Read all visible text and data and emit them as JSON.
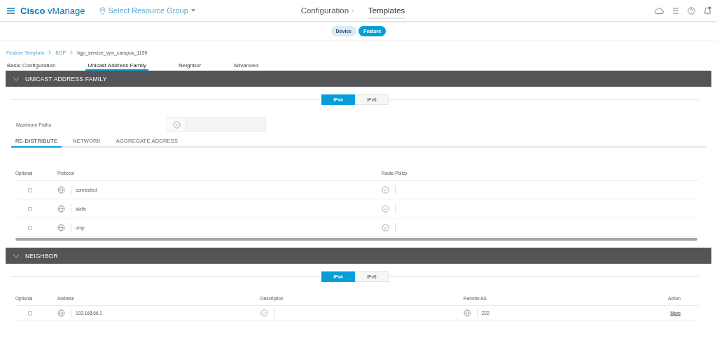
{
  "header": {
    "brand_bold": "Cisco",
    "brand_rest": "vManage",
    "resource_group": "Select Resource Group",
    "title": "Configuration",
    "separator": "·",
    "subtitle": "Templates"
  },
  "template_toggle": [
    {
      "label": "Device",
      "selected": false
    },
    {
      "label": "Feature",
      "selected": true
    }
  ],
  "breadcrumb": [
    "Feature Template",
    "BGP",
    "bgp_service_vpn_campus_1159"
  ],
  "tabs": [
    {
      "label": "Basic Configuration",
      "selected": false
    },
    {
      "label": "Unicast Address Family",
      "selected": true
    },
    {
      "label": "Neighbor",
      "selected": false
    },
    {
      "label": "Advanced",
      "selected": false
    }
  ],
  "unicast": {
    "title": "UNICAST ADDRESS FAMILY",
    "ip_toggle": [
      {
        "label": "IPv4",
        "selected": true
      },
      {
        "label": "IPv6",
        "selected": false
      }
    ],
    "maximum_paths": {
      "label": "Maximum Paths"
    },
    "subtabs": [
      {
        "label": "RE-DISTRIBUTE",
        "selected": true
      },
      {
        "label": "NETWORK",
        "selected": false
      },
      {
        "label": "AGGREGATE ADDRESS",
        "selected": false
      }
    ],
    "table": {
      "columns": [
        "Optional",
        "Protocol",
        "Route Policy"
      ],
      "rows": [
        {
          "checked": false,
          "protocol": "connected"
        },
        {
          "checked": false,
          "protocol": "static"
        },
        {
          "checked": false,
          "protocol": "omp"
        }
      ]
    }
  },
  "neighbor": {
    "title": "NEIGHBOR",
    "ip_toggle": [
      {
        "label": "IPv4",
        "selected": true
      },
      {
        "label": "IPv6",
        "selected": false
      }
    ],
    "table": {
      "columns": [
        "Optional",
        "Address",
        "Description",
        "Remote AS",
        "Action"
      ],
      "rows": [
        {
          "checked": false,
          "address": "192.168.66.1",
          "remote_as": "222",
          "action": "More"
        }
      ]
    }
  }
}
